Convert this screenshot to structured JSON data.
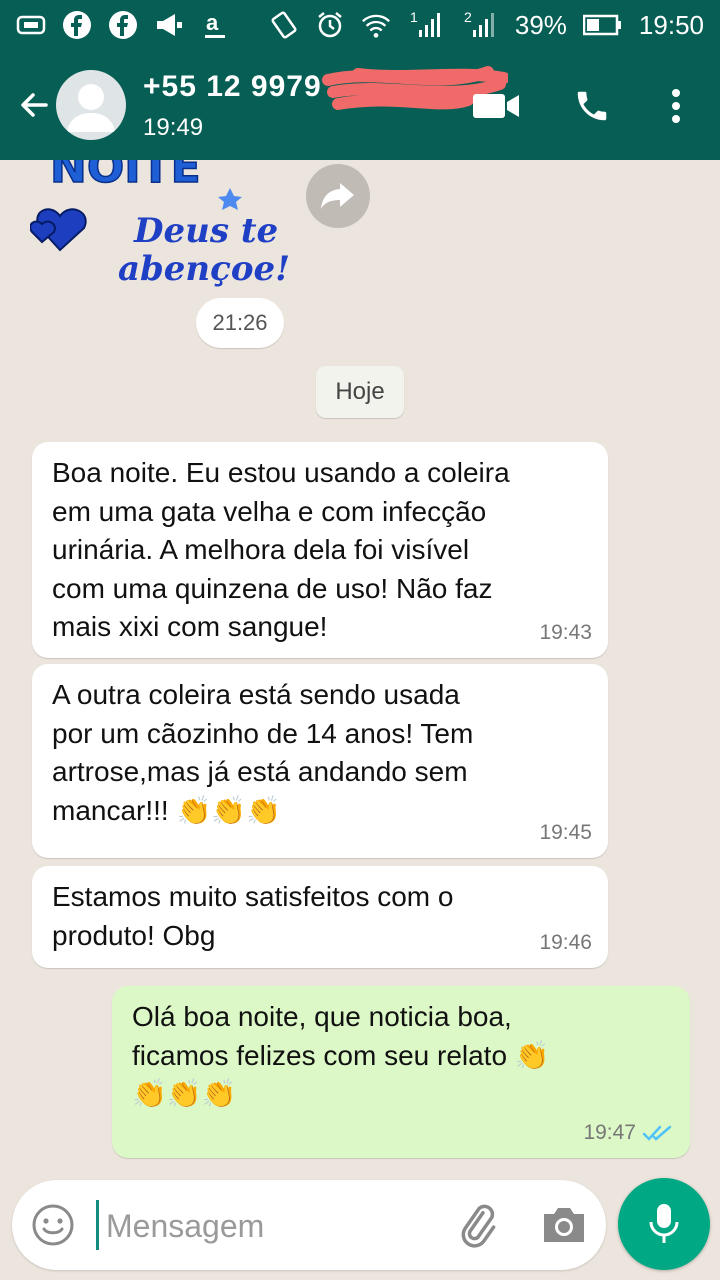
{
  "status_bar": {
    "battery": "39%",
    "time": "19:50",
    "sim1": "1",
    "sim2": "2"
  },
  "header": {
    "contact_name": "+55 12 9979",
    "last_seen": "19:49"
  },
  "chat": {
    "sticker": {
      "line1": "NOITE",
      "line2": "Deus te",
      "line3": "abençoe!"
    },
    "sticker_time": "21:26",
    "date_separator": "Hoje",
    "messages": [
      {
        "text": "Boa noite. Eu estou usando a coleira\nem uma gata velha e com infecção\nurinária. A melhora dela foi visível\ncom uma quinzena de uso! Não faz\nmais xixi com sangue!",
        "time": "19:43"
      },
      {
        "text": "A outra coleira está sendo usada\npor um cãozinho de 14 anos! Tem\nartrose,mas já está andando sem\nmancar!!! 👏👏👏",
        "time": "19:45"
      },
      {
        "text": "Estamos muito satisfeitos com o\nproduto! Obg",
        "time": "19:46"
      },
      {
        "text": "Olá boa noite, que noticia boa,\nficamos felizes com seu relato 👏\n👏👏👏",
        "time": "19:47"
      }
    ]
  },
  "composer": {
    "placeholder": "Mensagem"
  },
  "colors": {
    "header": "#075e54",
    "chat_bg": "#ece5dd",
    "incoming": "#ffffff",
    "outgoing": "#dcf8c6",
    "accent": "#00a884",
    "read_ticks": "#4fc3f7"
  },
  "icons": [
    "sim-card-icon",
    "facebook-icon",
    "megaphone-icon",
    "amazon-icon",
    "vibrate-icon",
    "alarm-icon",
    "wifi-icon",
    "signal-icon",
    "battery-icon",
    "back-arrow-icon",
    "avatar-icon",
    "video-call-icon",
    "phone-icon",
    "more-vert-icon",
    "forward-icon",
    "double-check-icon",
    "emoji-icon",
    "paperclip-icon",
    "camera-icon",
    "mic-icon"
  ]
}
